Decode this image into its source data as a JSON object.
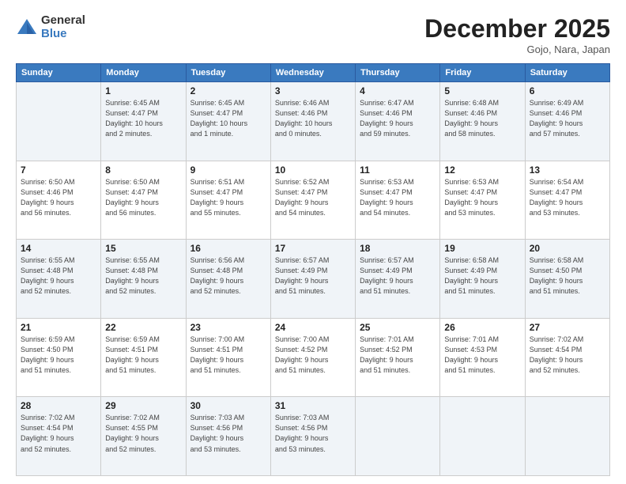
{
  "logo": {
    "general": "General",
    "blue": "Blue"
  },
  "header": {
    "month": "December 2025",
    "location": "Gojo, Nara, Japan"
  },
  "weekdays": [
    "Sunday",
    "Monday",
    "Tuesday",
    "Wednesday",
    "Thursday",
    "Friday",
    "Saturday"
  ],
  "weeks": [
    [
      {
        "day": "",
        "info": ""
      },
      {
        "day": "1",
        "info": "Sunrise: 6:45 AM\nSunset: 4:47 PM\nDaylight: 10 hours\nand 2 minutes."
      },
      {
        "day": "2",
        "info": "Sunrise: 6:45 AM\nSunset: 4:47 PM\nDaylight: 10 hours\nand 1 minute."
      },
      {
        "day": "3",
        "info": "Sunrise: 6:46 AM\nSunset: 4:46 PM\nDaylight: 10 hours\nand 0 minutes."
      },
      {
        "day": "4",
        "info": "Sunrise: 6:47 AM\nSunset: 4:46 PM\nDaylight: 9 hours\nand 59 minutes."
      },
      {
        "day": "5",
        "info": "Sunrise: 6:48 AM\nSunset: 4:46 PM\nDaylight: 9 hours\nand 58 minutes."
      },
      {
        "day": "6",
        "info": "Sunrise: 6:49 AM\nSunset: 4:46 PM\nDaylight: 9 hours\nand 57 minutes."
      }
    ],
    [
      {
        "day": "7",
        "info": "Sunrise: 6:50 AM\nSunset: 4:46 PM\nDaylight: 9 hours\nand 56 minutes."
      },
      {
        "day": "8",
        "info": "Sunrise: 6:50 AM\nSunset: 4:47 PM\nDaylight: 9 hours\nand 56 minutes."
      },
      {
        "day": "9",
        "info": "Sunrise: 6:51 AM\nSunset: 4:47 PM\nDaylight: 9 hours\nand 55 minutes."
      },
      {
        "day": "10",
        "info": "Sunrise: 6:52 AM\nSunset: 4:47 PM\nDaylight: 9 hours\nand 54 minutes."
      },
      {
        "day": "11",
        "info": "Sunrise: 6:53 AM\nSunset: 4:47 PM\nDaylight: 9 hours\nand 54 minutes."
      },
      {
        "day": "12",
        "info": "Sunrise: 6:53 AM\nSunset: 4:47 PM\nDaylight: 9 hours\nand 53 minutes."
      },
      {
        "day": "13",
        "info": "Sunrise: 6:54 AM\nSunset: 4:47 PM\nDaylight: 9 hours\nand 53 minutes."
      }
    ],
    [
      {
        "day": "14",
        "info": "Sunrise: 6:55 AM\nSunset: 4:48 PM\nDaylight: 9 hours\nand 52 minutes."
      },
      {
        "day": "15",
        "info": "Sunrise: 6:55 AM\nSunset: 4:48 PM\nDaylight: 9 hours\nand 52 minutes."
      },
      {
        "day": "16",
        "info": "Sunrise: 6:56 AM\nSunset: 4:48 PM\nDaylight: 9 hours\nand 52 minutes."
      },
      {
        "day": "17",
        "info": "Sunrise: 6:57 AM\nSunset: 4:49 PM\nDaylight: 9 hours\nand 51 minutes."
      },
      {
        "day": "18",
        "info": "Sunrise: 6:57 AM\nSunset: 4:49 PM\nDaylight: 9 hours\nand 51 minutes."
      },
      {
        "day": "19",
        "info": "Sunrise: 6:58 AM\nSunset: 4:49 PM\nDaylight: 9 hours\nand 51 minutes."
      },
      {
        "day": "20",
        "info": "Sunrise: 6:58 AM\nSunset: 4:50 PM\nDaylight: 9 hours\nand 51 minutes."
      }
    ],
    [
      {
        "day": "21",
        "info": "Sunrise: 6:59 AM\nSunset: 4:50 PM\nDaylight: 9 hours\nand 51 minutes."
      },
      {
        "day": "22",
        "info": "Sunrise: 6:59 AM\nSunset: 4:51 PM\nDaylight: 9 hours\nand 51 minutes."
      },
      {
        "day": "23",
        "info": "Sunrise: 7:00 AM\nSunset: 4:51 PM\nDaylight: 9 hours\nand 51 minutes."
      },
      {
        "day": "24",
        "info": "Sunrise: 7:00 AM\nSunset: 4:52 PM\nDaylight: 9 hours\nand 51 minutes."
      },
      {
        "day": "25",
        "info": "Sunrise: 7:01 AM\nSunset: 4:52 PM\nDaylight: 9 hours\nand 51 minutes."
      },
      {
        "day": "26",
        "info": "Sunrise: 7:01 AM\nSunset: 4:53 PM\nDaylight: 9 hours\nand 51 minutes."
      },
      {
        "day": "27",
        "info": "Sunrise: 7:02 AM\nSunset: 4:54 PM\nDaylight: 9 hours\nand 52 minutes."
      }
    ],
    [
      {
        "day": "28",
        "info": "Sunrise: 7:02 AM\nSunset: 4:54 PM\nDaylight: 9 hours\nand 52 minutes."
      },
      {
        "day": "29",
        "info": "Sunrise: 7:02 AM\nSunset: 4:55 PM\nDaylight: 9 hours\nand 52 minutes."
      },
      {
        "day": "30",
        "info": "Sunrise: 7:03 AM\nSunset: 4:56 PM\nDaylight: 9 hours\nand 53 minutes."
      },
      {
        "day": "31",
        "info": "Sunrise: 7:03 AM\nSunset: 4:56 PM\nDaylight: 9 hours\nand 53 minutes."
      },
      {
        "day": "",
        "info": ""
      },
      {
        "day": "",
        "info": ""
      },
      {
        "day": "",
        "info": ""
      }
    ]
  ]
}
